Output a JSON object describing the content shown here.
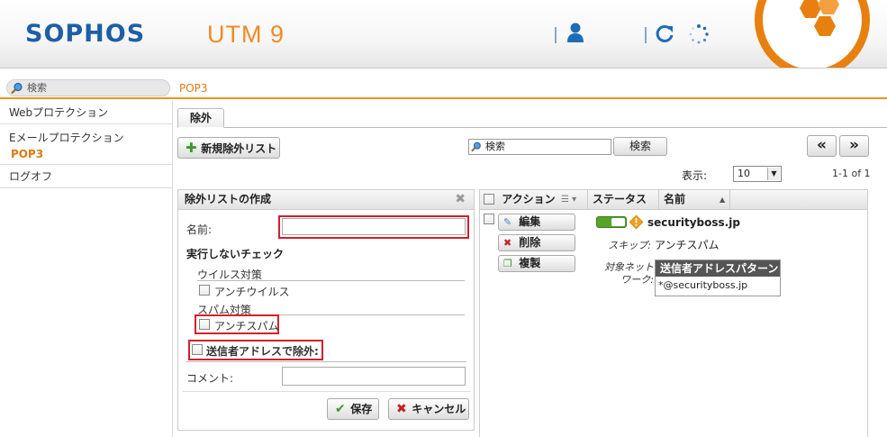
{
  "header": {
    "logo": "SOPHOS",
    "product": "UTM 9",
    "brand_color": "#1e5fa6",
    "accent_color": "#f08a24",
    "icons": [
      "user-icon",
      "refresh-icon",
      "loading-icon"
    ]
  },
  "topbar": {
    "search_placeholder": "検索",
    "breadcrumb": "POP3"
  },
  "sidebar": {
    "items": [
      {
        "label": "Webプロテクション"
      },
      {
        "label": "Eメールプロテクション",
        "sub": "POP3"
      },
      {
        "label": "ログオフ"
      }
    ]
  },
  "tabs": [
    {
      "label": "除外",
      "active": true
    }
  ],
  "toolbar": {
    "new_list_label": "新規除外リスト",
    "search_value": "検索",
    "search_button_label": "検索",
    "prev_label": "«",
    "next_label": "»"
  },
  "pager": {
    "display_label": "表示:",
    "display_value": "10",
    "count_text": "1-1 of 1"
  },
  "create_panel": {
    "title": "除外リストの作成",
    "close_label": "✖",
    "name_label": "名前:",
    "name_value": "",
    "skip_section_title": "実行しないチェック",
    "virus_heading": "ウイルス対策",
    "antivirus_label": "アンチウイルス",
    "spam_heading": "スパム対策",
    "antispam_label": "アンチスパム",
    "sender_exclude_label": "送信者アドレスで除外:",
    "comment_label": "コメント:",
    "comment_value": "",
    "save_label": "保存",
    "cancel_label": "キャンセル",
    "highlight_color": "#d3202a"
  },
  "table": {
    "columns": [
      "アクション",
      "ステータス",
      "名前"
    ],
    "row": {
      "actions": [
        "編集",
        "削除",
        "複製"
      ],
      "status_enabled": true,
      "name": "securityboss.jp",
      "skip_label": "スキップ:",
      "skip_value": "アンチスパム",
      "target_label_1": "対象ネット",
      "target_label_2": "ワーク:",
      "pattern_header": "送信者アドレスパターン",
      "pattern_value": "*@securityboss.jp"
    }
  }
}
